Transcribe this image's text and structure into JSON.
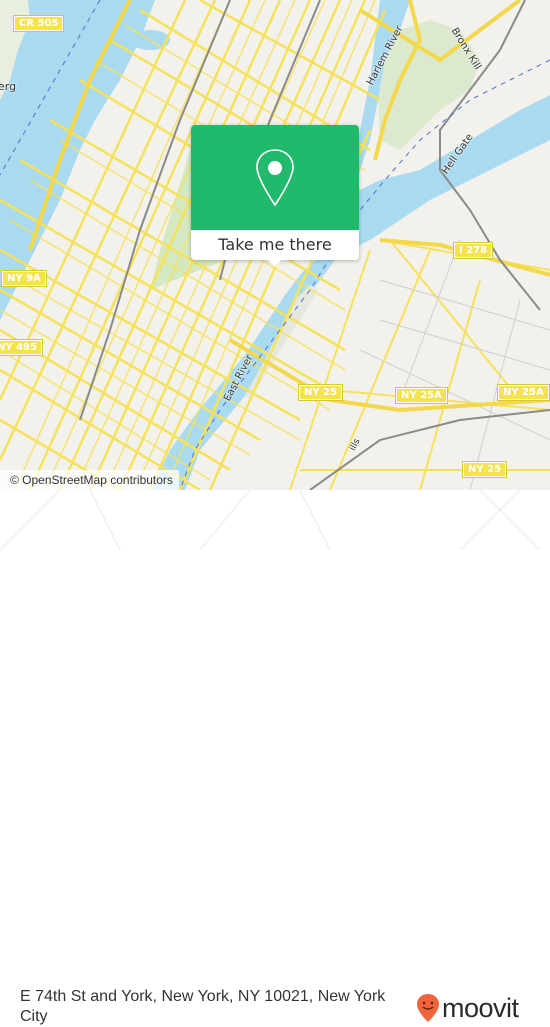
{
  "map": {
    "attribution": "© OpenStreetMap contributors",
    "labels": {
      "harlem_river": "Harlem River",
      "bronx_kill": "Bronx Kill",
      "hell_gate": "Hell Gate",
      "east_river": "East River",
      "berg": "erg",
      "hills": "ills"
    },
    "shields": {
      "cr505": "CR 505",
      "ny9a": "NY 9A",
      "ny495": "NY 495",
      "i278": "I 278",
      "ny25_a": "NY 25",
      "ny25a_a": "NY 25A",
      "ny25a_b": "NY 25A",
      "ny25_b": "NY 25"
    },
    "colors": {
      "water": "#aadaf0",
      "land": "#f2f1ec",
      "park": "#d4e9c2",
      "road": "#f6e25a",
      "rail": "#8a8a8a"
    }
  },
  "popup": {
    "icon": "map-pin-icon",
    "button_label": "Take me there",
    "accent": "#21b96b"
  },
  "footer": {
    "address": "E 74th St and York, New York, NY 10021, New York City",
    "brand": "moovit",
    "brand_color": "#f0643c"
  }
}
